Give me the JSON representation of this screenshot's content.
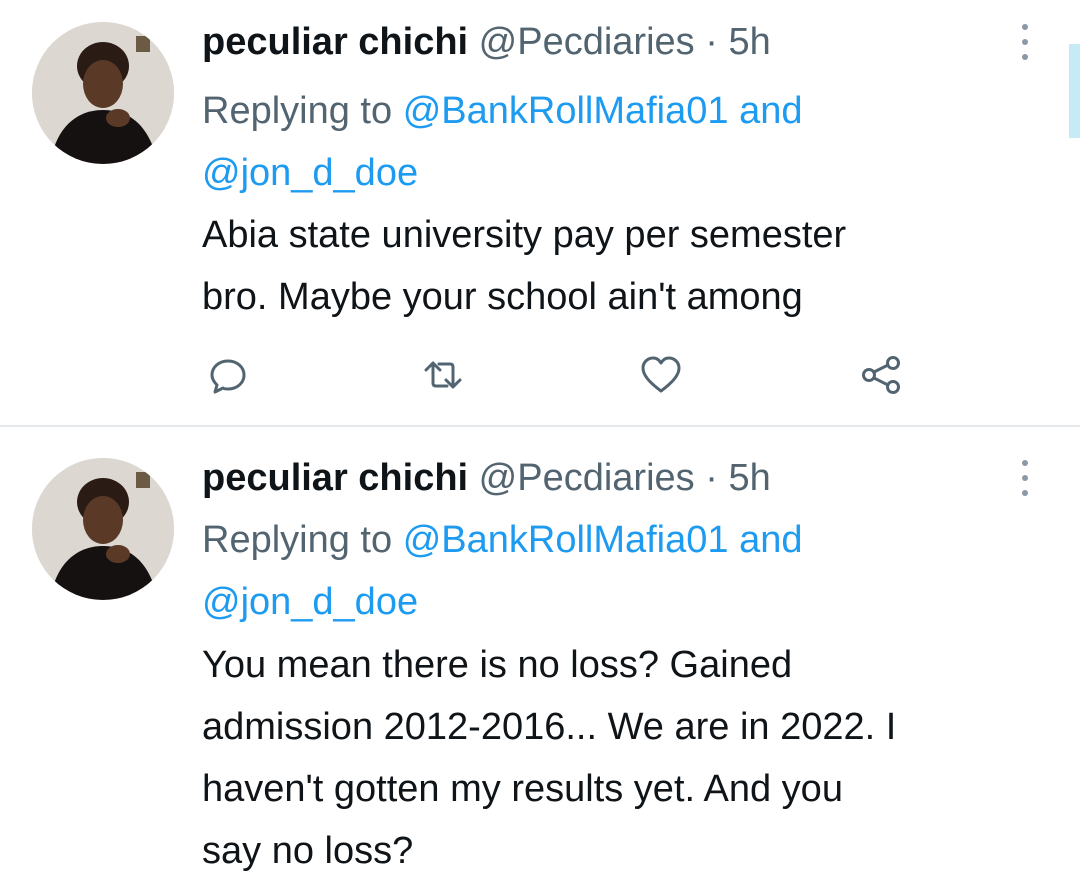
{
  "colors": {
    "text": "#0f1419",
    "secondary": "#536471",
    "link": "#1d9bf0",
    "divider": "#e6e9eb",
    "scrollbar": "#c7eaf7"
  },
  "tweets": [
    {
      "display_name": "peculiar chichi",
      "handle": "@Pecdiaries",
      "separator": "·",
      "time": "5h",
      "replying_prefix": "Replying to",
      "mention_1": "@BankRollMafia01",
      "mention_joiner": "and",
      "mention_2": "@jon_d_doe",
      "text": "Abia state university pay per semester\nbro. Maybe your school ain't among",
      "icons": [
        "reply-icon",
        "retweet-icon",
        "like-icon",
        "share-icon",
        "more-icon"
      ]
    },
    {
      "display_name": "peculiar chichi",
      "handle": "@Pecdiaries",
      "separator": "·",
      "time": "5h",
      "replying_prefix": "Replying to",
      "mention_1": "@BankRollMafia01",
      "mention_joiner": "and",
      "mention_2": "@jon_d_doe",
      "text": "You mean there is no loss? Gained\nadmission 2012-2016... We are in 2022. I\nhaven't gotten my results yet. And you\nsay no loss?",
      "icons": [
        "more-icon"
      ]
    }
  ]
}
